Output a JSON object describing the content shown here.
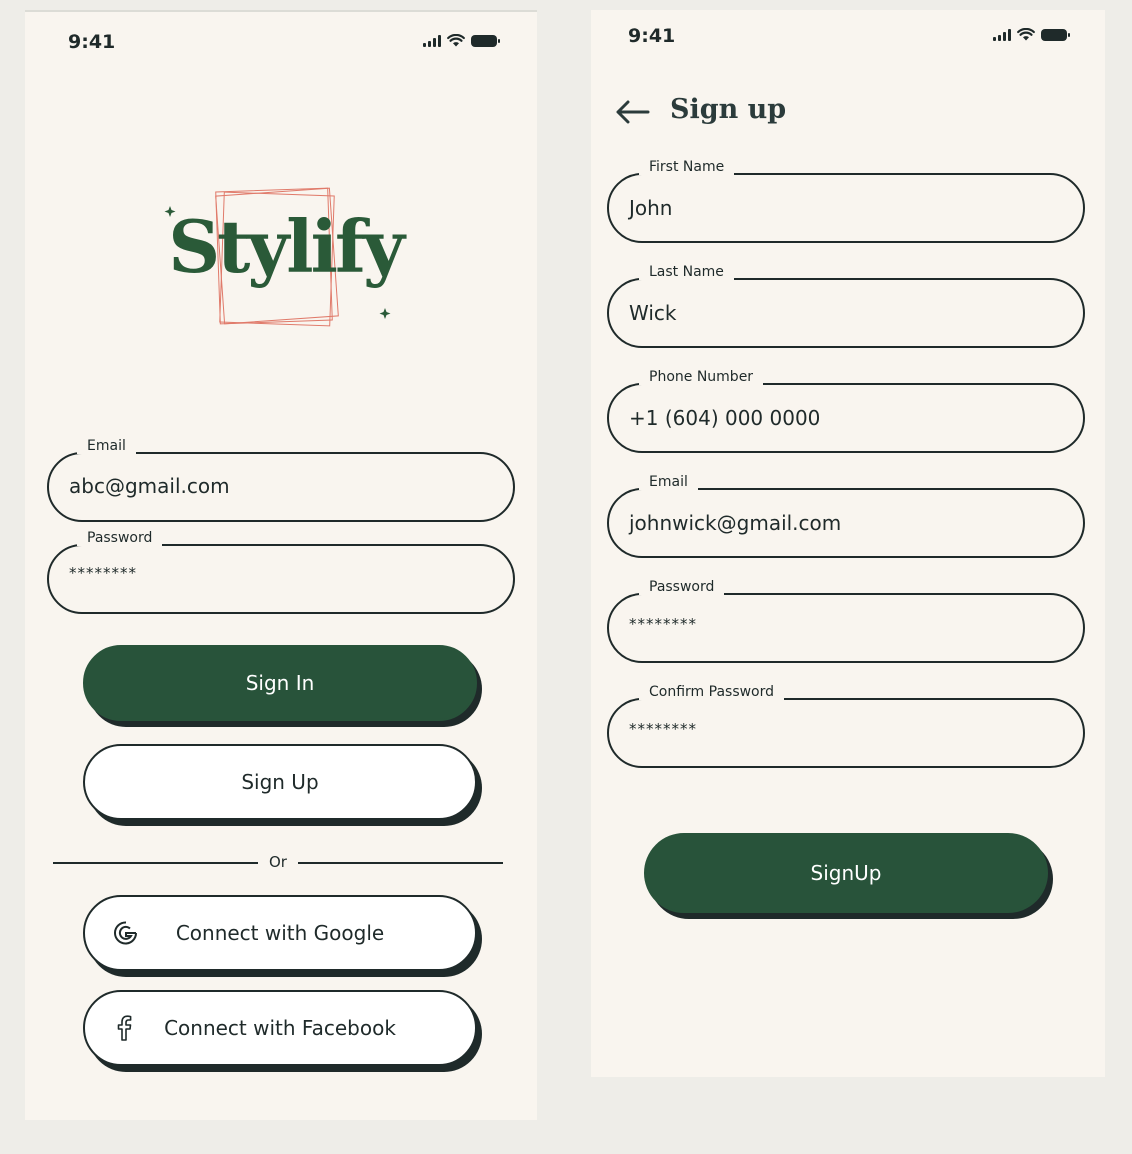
{
  "status_bar": {
    "time": "9:41"
  },
  "login": {
    "logo_text": "Stylify",
    "email": {
      "label": "Email",
      "value": "abc@gmail.com"
    },
    "password": {
      "label": "Password",
      "value": "********"
    },
    "sign_in_label": "Sign In",
    "sign_up_label": "Sign Up",
    "divider_text": "Or",
    "google_label": "Connect with Google",
    "facebook_label": "Connect with Facebook"
  },
  "signup": {
    "title": "Sign up",
    "fields": {
      "first_name": {
        "label": "First Name",
        "value": "John"
      },
      "last_name": {
        "label": "Last Name",
        "value": "Wick"
      },
      "phone": {
        "label": "Phone Number",
        "value": "+1 (604) 000 0000"
      },
      "email": {
        "label": "Email",
        "value": "johnwick@gmail.com"
      },
      "password": {
        "label": "Password",
        "value": "********"
      },
      "confirm_password": {
        "label": "Confirm Password",
        "value": "********"
      }
    },
    "submit_label": "SignUp"
  },
  "colors": {
    "background": "#eeede8",
    "screen": "#f9f5ef",
    "brand_green": "#28533a",
    "ink": "#1f2a2a",
    "logo_frame": "#e07a6a"
  },
  "icons": [
    "signal-icon",
    "wifi-icon",
    "battery-icon",
    "back-arrow-icon",
    "google-icon",
    "facebook-icon",
    "sparkle-icon"
  ]
}
